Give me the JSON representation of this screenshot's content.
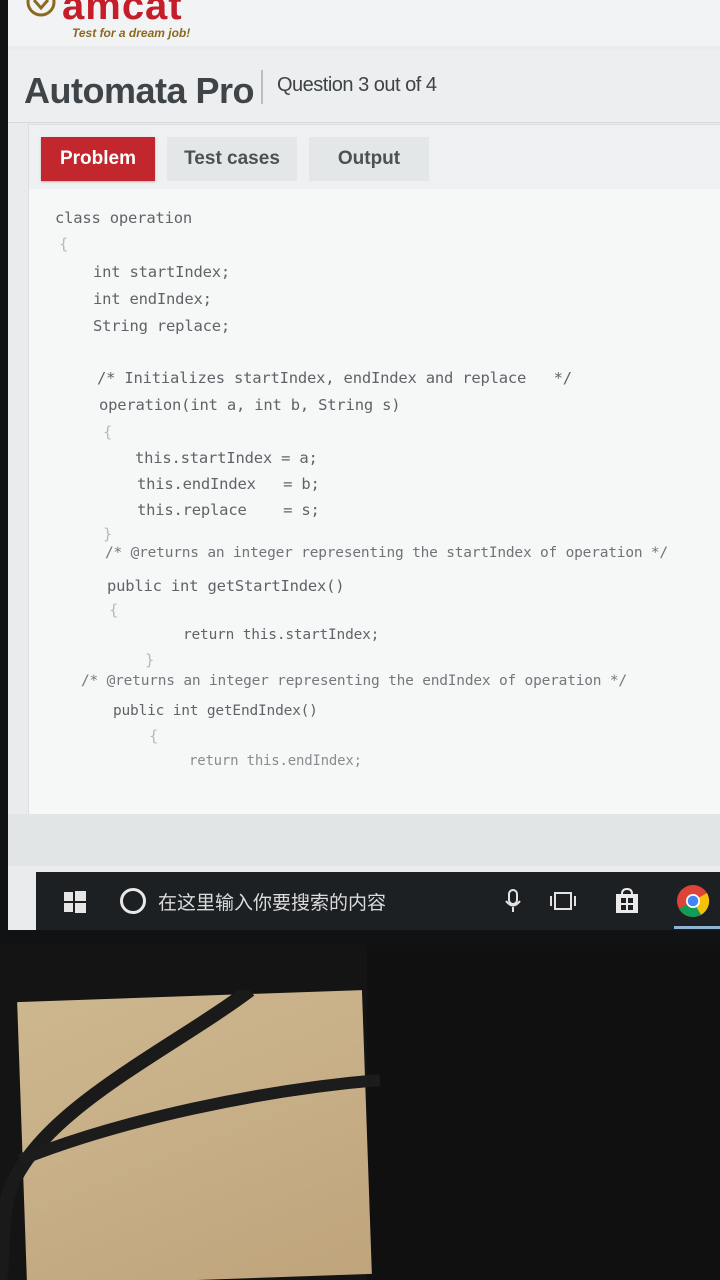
{
  "brand": {
    "logo_text": "amcat",
    "tagline": "Test for a dream job!"
  },
  "header": {
    "app_title": "Automata Pro",
    "question_counter": "Question 3 out of 4"
  },
  "tabs": [
    {
      "label": "Problem",
      "active": true
    },
    {
      "label": "Test cases",
      "active": false
    },
    {
      "label": "Output",
      "active": false
    }
  ],
  "code": {
    "lines": [
      "class operation",
      "{",
      "int startIndex;",
      "int endIndex;",
      "String replace;",
      "/* Initializes startIndex, endIndex and replace   */",
      "operation(int a, int b, String s)",
      "{",
      "this.startIndex = a;",
      "this.endIndex   = b;",
      "this.replace    = s;",
      "}",
      "/* @returns an integer representing the startIndex of operation */",
      "public int getStartIndex()",
      "{",
      "return this.startIndex;",
      "}",
      "/* @returns an integer representing the endIndex of operation */",
      "public int getEndIndex()",
      "{",
      "return this.endIndex;"
    ]
  },
  "taskbar": {
    "search_placeholder": "在这里输入你要搜索的内容",
    "icons": [
      "windows-start-icon",
      "search-icon",
      "microphone-icon",
      "task-view-icon",
      "store-icon",
      "chrome-icon"
    ]
  },
  "colors": {
    "accent": "#c1272d",
    "taskbar": "#1d2023"
  }
}
